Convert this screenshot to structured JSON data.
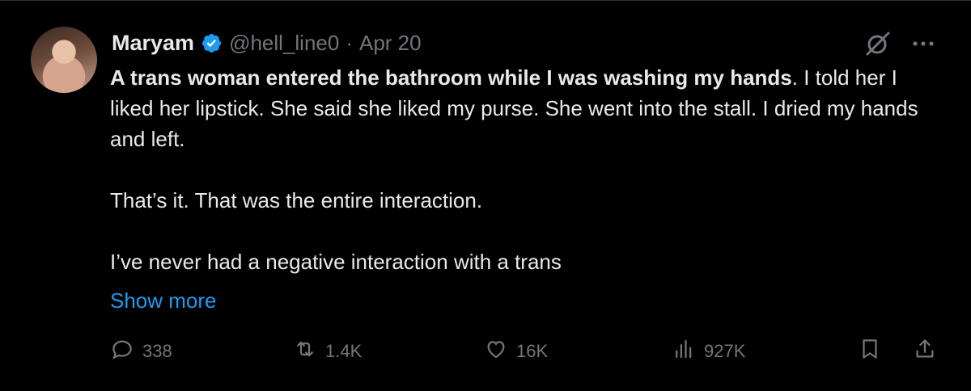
{
  "tweet": {
    "author_name": "Maryam",
    "handle": "@hell_line0",
    "separator": "·",
    "date": "Apr 20",
    "text_bold": "A trans woman entered the bathroom while I was washing my hands",
    "text_rest": ". I told her I liked her lipstick. She said she liked my purse. She went into the stall. I dried my hands and left.",
    "paragraph2": "That’s it. That was the entire interaction.",
    "paragraph3": "I’ve never had a negative interaction with a trans",
    "show_more": "Show more"
  },
  "actions": {
    "replies": "338",
    "reposts": "1.4K",
    "likes": "16K",
    "views": "927K"
  },
  "colors": {
    "background": "#000000",
    "text": "#e7e9ea",
    "muted": "#71767b",
    "link": "#1d9bf0",
    "verified": "#1d9bf0"
  },
  "icons": [
    "verified-badge-icon",
    "grok-icon",
    "more-icon",
    "reply-icon",
    "repost-icon",
    "like-icon",
    "views-icon",
    "bookmark-icon",
    "share-icon"
  ]
}
